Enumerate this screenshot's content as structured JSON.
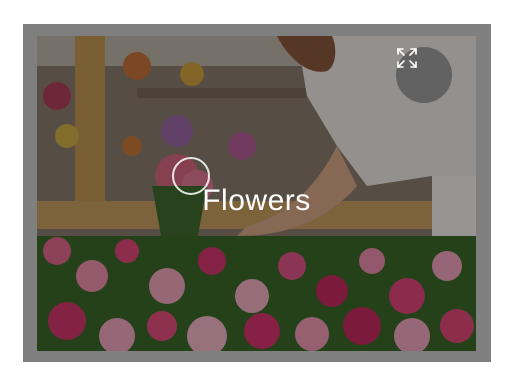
{
  "card": {
    "title": "Flowers"
  },
  "icons": {
    "fullscreen": "expand-arrows-icon"
  },
  "colors": {
    "frame": "#7f7f7f",
    "overlay": "rgba(0,0,0,0.38)",
    "title_text": "#ffffff"
  }
}
